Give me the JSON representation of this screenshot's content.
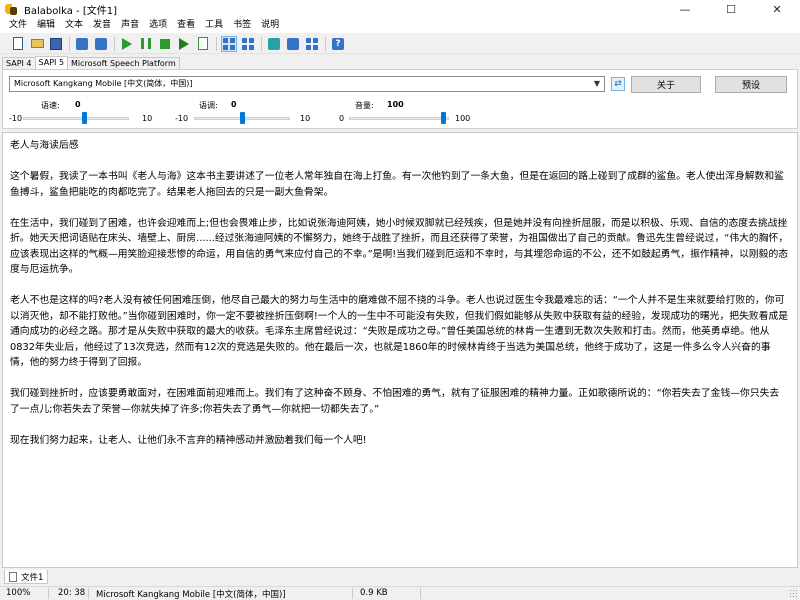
{
  "window": {
    "title": "Balabolka - [文件1]",
    "minimize": "—",
    "maximize": "☐",
    "close": "✕"
  },
  "menu": [
    "文件",
    "编辑",
    "文本",
    "发音",
    "声音",
    "选项",
    "查看",
    "工具",
    "书签",
    "说明"
  ],
  "toolbar": {
    "icons": [
      "new-document-icon",
      "open-folder-icon",
      "save-icon",
      "save-audio-icon",
      "split-audio-icon",
      "play-icon",
      "pause-icon",
      "stop-icon",
      "read-clipboard-icon",
      "read-selection-icon",
      "voice-settings-icon",
      "pronunciation-icon",
      "tools-icon",
      "dictionary-icon",
      "help-icon"
    ],
    "active": "voice-settings-icon"
  },
  "sapi_tabs": [
    "SAPI 4",
    "SAPI 5",
    "Microsoft Speech Platform"
  ],
  "sapi_selected": "SAPI 5",
  "voice": {
    "selected": "Microsoft Kangkang Mobile [中文(简体，中国)]",
    "about_button": "关于",
    "preview_button": "预设"
  },
  "sliders": [
    {
      "label": "语速:",
      "value": "0",
      "min": "-10",
      "max": "10",
      "fraction": 0.5
    },
    {
      "label": "语调:",
      "value": "0",
      "min": "-10",
      "max": "10",
      "fraction": 0.5
    },
    {
      "label": "音量:",
      "value": "100",
      "min": "0",
      "max": "100",
      "fraction": 1.0
    }
  ],
  "document": {
    "paragraphs": [
      "老人与海读后感",
      "这个暑假，我读了一本书叫《老人与海》这本书主要讲述了一位老人常年独自在海上打鱼。有一次他钓到了一条大鱼，但是在返回的路上碰到了成群的鲨鱼。老人使出浑身解数和鲨鱼搏斗，鲨鱼把能吃的肉都吃完了。结果老人拖回去的只是一副大鱼骨架。",
      "在生活中，我们碰到了困难，也许会迎难而上;但也会畏难止步，比如说张海迪阿姨，她小时候双脚就已经残疾，但是她并没有向挫折屈服，而是以积极、乐观、自信的态度去挑战挫折。她天天把词语贴在床头、墙壁上、厨房......经过张海迪阿姨的不懈努力，她终于战胜了挫折，而且还获得了荣誉，为祖国做出了自己的贡献。鲁迅先生曾经说过，“伟大的胸怀，应该表现出这样的气概—用笑脸迎接悲惨的命运，用自信的勇气来应付自己的不幸。”是啊!当我们碰到厄运和不幸时，与其埋怨命运的不公，还不如鼓起勇气，振作精神，以刚毅的态度与厄运抗争。",
      "老人不也是这样的吗?老人没有被任何困难压倒，他尽自己最大的努力与生活中的磨难做不屈不挠的斗争。老人也说过医生令我最难忘的话：“一个人并不是生来就要给打败的，你可以消灭他，却不能打败他。”当你碰到困难时，你一定不要被挫折压倒啊!一个人的一生中不可能没有失败，但我们假如能够从失败中获取有益的经验，发现成功的曙光，把失败看成是通向成功的必经之路。那才是从失败中获取的最大的收获。毛泽东主席曾经说过：“失败是成功之母。”曾任美国总统的林肯一生遭到无数次失败和打击。然而，他英勇卓绝。他从0832年失业后，他经过了13次竞选，然而有12次的竞选是失败的。他在最后一次，也就是1860年的时候林肯终于当选为美国总统，他终于成功了，这是一件多么令人兴奋的事情，他的努力终于得到了回报。",
      "我们碰到挫折时，应该要勇敢面对，在困难面前迎难而上。我们有了这种奋不顾身、不怕困难的勇气，就有了征服困难的精神力量。正如歌德所说的：“你若失去了金钱—你只失去了一点儿;你若失去了荣誉—你就失掉了许多;你若失去了勇气—你就把一切都失去了。”",
      "现在我们努力起来，让老人、让他们永不言弃的精神感动并激励着我们每一个人吧!"
    ]
  },
  "doc_tab": "文件1",
  "status": {
    "zoom": "100%",
    "position": "20:  38",
    "voice": "Microsoft Kangkang Mobile [中文(简体，中国)]",
    "size": "0.9 KB"
  }
}
